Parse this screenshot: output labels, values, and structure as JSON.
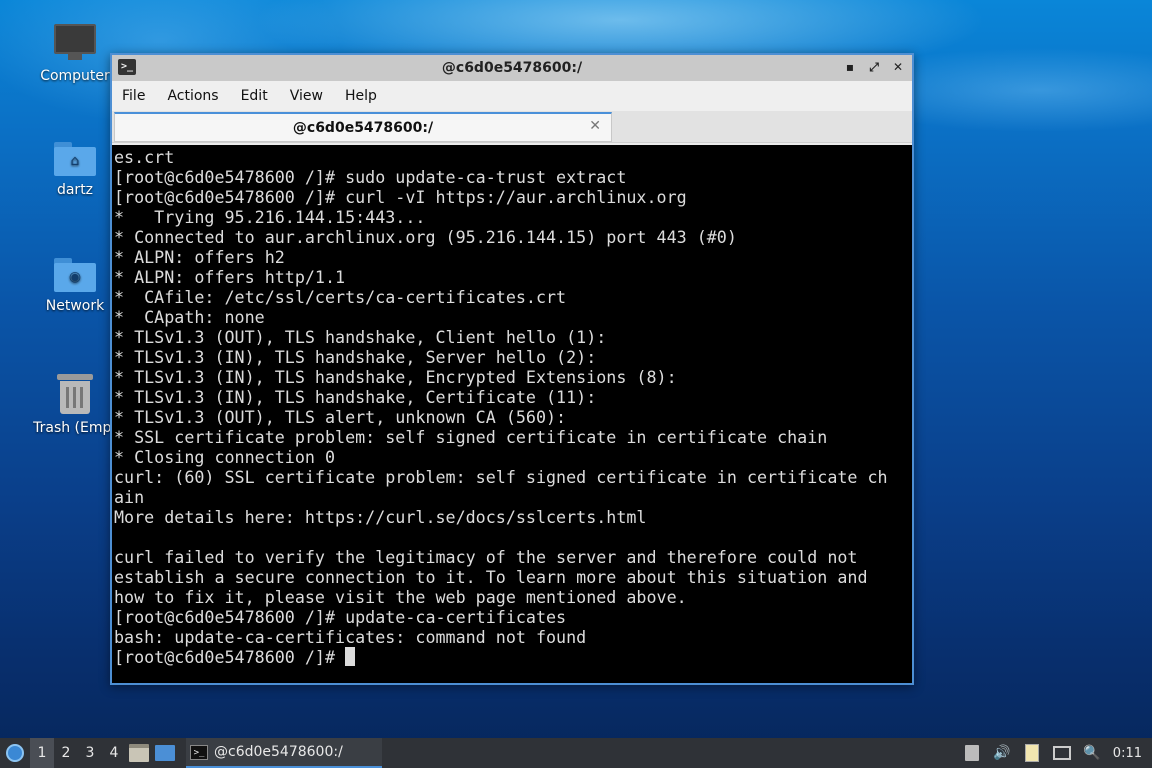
{
  "desktop": {
    "icons": [
      {
        "label": "Computer",
        "icon": "computer-icon"
      },
      {
        "label": "dartz",
        "icon": "home-folder-icon"
      },
      {
        "label": "Network",
        "icon": "network-folder-icon"
      },
      {
        "label": "Trash (Empt",
        "icon": "trash-icon"
      }
    ]
  },
  "window": {
    "title": "@c6d0e5478600:/",
    "controls": {
      "minimize": "▪",
      "maximize": "⤢",
      "close": "✕"
    },
    "menu": [
      "File",
      "Actions",
      "Edit",
      "View",
      "Help"
    ],
    "tab": {
      "label": "@c6d0e5478600:/",
      "close": "✕"
    },
    "terminal_lines": [
      "es.crt",
      "[root@c6d0e5478600 /]# sudo update-ca-trust extract",
      "[root@c6d0e5478600 /]# curl -vI https://aur.archlinux.org",
      "*   Trying 95.216.144.15:443...",
      "* Connected to aur.archlinux.org (95.216.144.15) port 443 (#0)",
      "* ALPN: offers h2",
      "* ALPN: offers http/1.1",
      "*  CAfile: /etc/ssl/certs/ca-certificates.crt",
      "*  CApath: none",
      "* TLSv1.3 (OUT), TLS handshake, Client hello (1):",
      "* TLSv1.3 (IN), TLS handshake, Server hello (2):",
      "* TLSv1.3 (IN), TLS handshake, Encrypted Extensions (8):",
      "* TLSv1.3 (IN), TLS handshake, Certificate (11):",
      "* TLSv1.3 (OUT), TLS alert, unknown CA (560):",
      "* SSL certificate problem: self signed certificate in certificate chain",
      "* Closing connection 0",
      "curl: (60) SSL certificate problem: self signed certificate in certificate ch",
      "ain",
      "More details here: https://curl.se/docs/sslcerts.html",
      "",
      "curl failed to verify the legitimacy of the server and therefore could not",
      "establish a secure connection to it. To learn more about this situation and",
      "how to fix it, please visit the web page mentioned above.",
      "[root@c6d0e5478600 /]# update-ca-certificates",
      "bash: update-ca-certificates: command not found"
    ],
    "prompt": "[root@c6d0e5478600 /]# "
  },
  "taskbar": {
    "workspaces": [
      "1",
      "2",
      "3",
      "4"
    ],
    "active_workspace": "1",
    "task_label": "@c6d0e5478600:/",
    "clock": "0:11",
    "tray_icons": [
      "removable-media-icon",
      "volume-icon",
      "clipboard-icon",
      "network-icon",
      "notification-icon"
    ]
  },
  "colors": {
    "accent": "#4a90d9",
    "terminal_bg": "#000000",
    "terminal_fg": "#dcdcdc",
    "taskbar_bg": "#2f3237"
  }
}
